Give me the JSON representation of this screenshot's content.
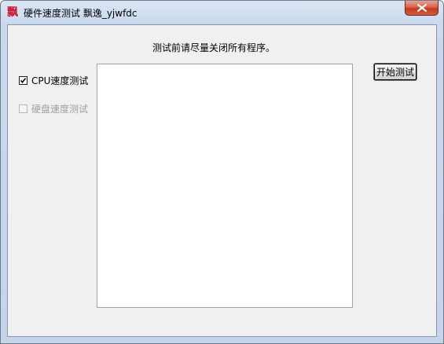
{
  "window": {
    "app_icon_glyph": "飘",
    "title": "硬件速度测试 飘逸_yjwfdc"
  },
  "main": {
    "notice": "测试前请尽量关闭所有程序。",
    "cpu_test": {
      "label": "CPU速度测试",
      "checked": true
    },
    "disk_test": {
      "label": "硬盘速度测试",
      "checked": false,
      "enabled": false
    },
    "output_text": "",
    "start_button_label": "开始测试"
  }
}
